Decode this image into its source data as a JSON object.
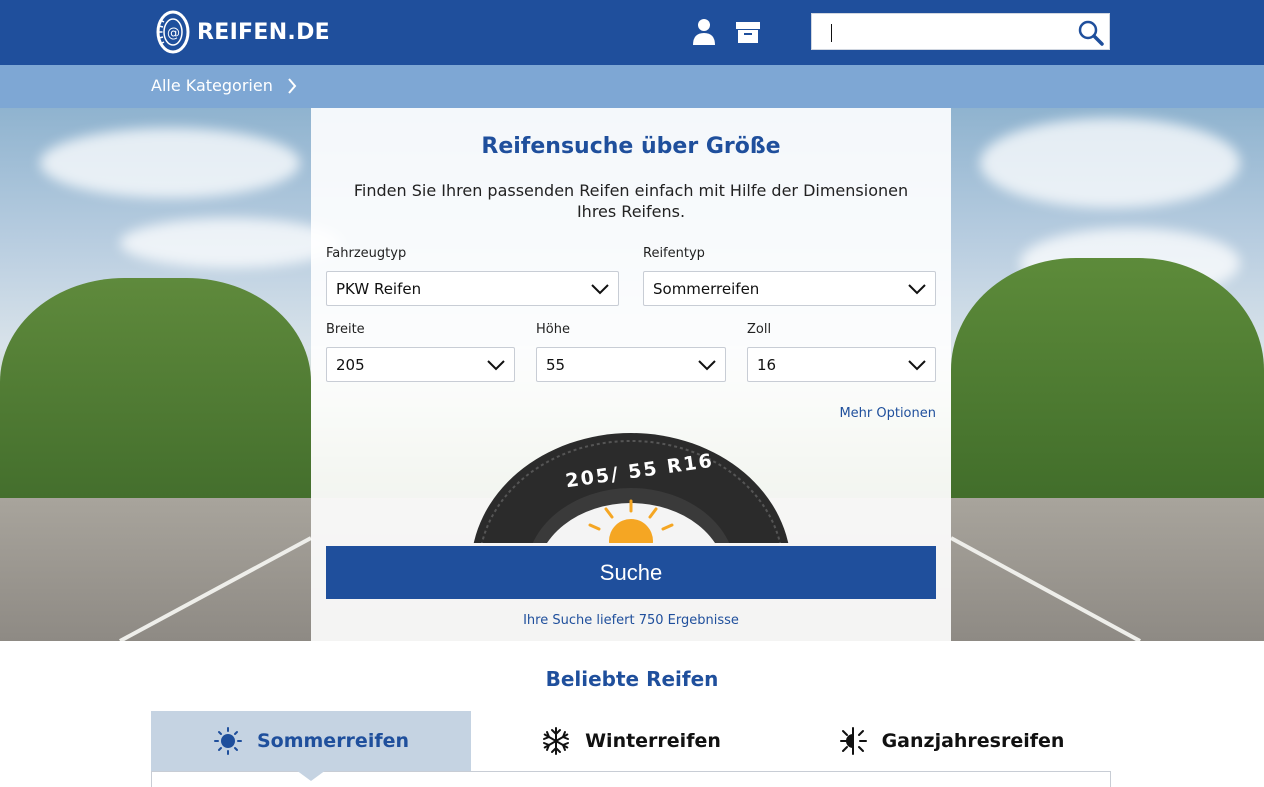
{
  "header": {
    "brand": "REIFEN.DE",
    "icons": [
      "user-icon",
      "archive-icon"
    ],
    "search": {
      "value": "",
      "placeholder": ""
    }
  },
  "catbar": {
    "label": "Alle Kategorien"
  },
  "search_panel": {
    "title": "Reifensuche über Größe",
    "description": "Finden Sie Ihren passenden Reifen einfach mit Hilfe der Dimensionen Ihres Reifens.",
    "fields": {
      "vehicle_type": {
        "label": "Fahrzeugtyp",
        "value": "PKW Reifen"
      },
      "tire_type": {
        "label": "Reifentyp",
        "value": "Sommerreifen"
      },
      "width": {
        "label": "Breite",
        "value": "205"
      },
      "height": {
        "label": "Höhe",
        "value": "55"
      },
      "rim": {
        "label": "Zoll",
        "value": "16"
      }
    },
    "more_options": "Mehr Optionen",
    "tire_marking": "205/ 55 R16",
    "submit": "Suche",
    "result_text": "Ihre Suche liefert 750 Ergebnisse"
  },
  "popular": {
    "title": "Beliebte Reifen",
    "tabs": [
      {
        "label": "Sommerreifen",
        "icon": "sun-icon",
        "active": true
      },
      {
        "label": "Winterreifen",
        "icon": "snowflake-icon",
        "active": false
      },
      {
        "label": "Ganzjahresreifen",
        "icon": "sun-snowflake-icon",
        "active": false
      }
    ]
  },
  "colors": {
    "primary": "#1f4f9c",
    "catbar": "#7ea7d4",
    "active_tab": "#c5d3e2",
    "sun": "#f5a623"
  }
}
